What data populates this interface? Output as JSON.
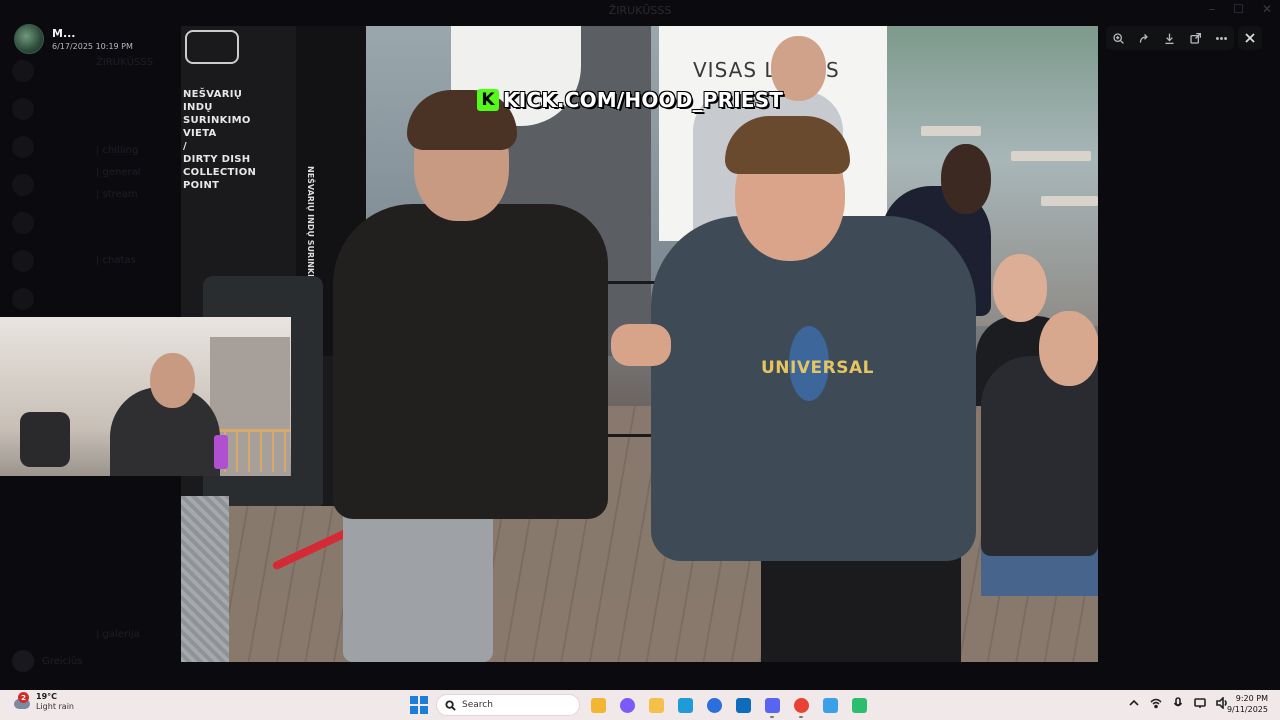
{
  "background_app": {
    "window_title": "ŽIRUKŪSSS",
    "window_controls": [
      "–",
      "☐",
      "✕"
    ],
    "channels": [
      "ŽIRUKŪSSS",
      "| chilling",
      "| general",
      "| stream",
      "| chatas",
      "| galerija"
    ],
    "footer_user": "Greiciūs"
  },
  "viewer": {
    "author_name": "M...",
    "timestamp": "6/17/2025 10:19 PM",
    "tools": [
      "zoom-in-icon",
      "forward-icon",
      "download-icon",
      "open-external-icon",
      "more-icon"
    ],
    "close_icon": "close-icon"
  },
  "media": {
    "banner_k": "K",
    "banner_text": "KICK.COM/HOOD_PRIEST",
    "store_sign": "NEŠVARIŲ\nINDŲ\nSURINKIMO\nVIETA\n/\nDIRTY DISH\nCOLLECTION\nPOINT",
    "pillar_text": "NEŠVARIŲ INDŲ SURINKIMO VIETA",
    "poster_text": "VISAS L     SKAS",
    "hoodie_text": "UNIVERSAL"
  },
  "taskbar": {
    "weather_badge": "2",
    "weather_temp": "19°C",
    "weather_desc": "Light rain",
    "search_placeholder": "Search",
    "apps": [
      {
        "name": "file-explorer-icon",
        "color": "#f2b632"
      },
      {
        "name": "copilot-icon",
        "color": "#7a5af8"
      },
      {
        "name": "folder-icon",
        "color": "#f5c04a"
      },
      {
        "name": "edge-icon",
        "color": "#1f9bd8"
      },
      {
        "name": "store-icon",
        "color": "#2a6fdb"
      },
      {
        "name": "outlook-icon",
        "color": "#0f6cbd"
      },
      {
        "name": "discord-icon",
        "color": "#5865f2"
      },
      {
        "name": "chrome-icon",
        "color": "#e94235"
      },
      {
        "name": "snipping-icon",
        "color": "#3aa0e8"
      },
      {
        "name": "app-icon",
        "color": "#2dbd6e"
      }
    ],
    "time": "9:20 PM",
    "date": "9/11/2025"
  }
}
